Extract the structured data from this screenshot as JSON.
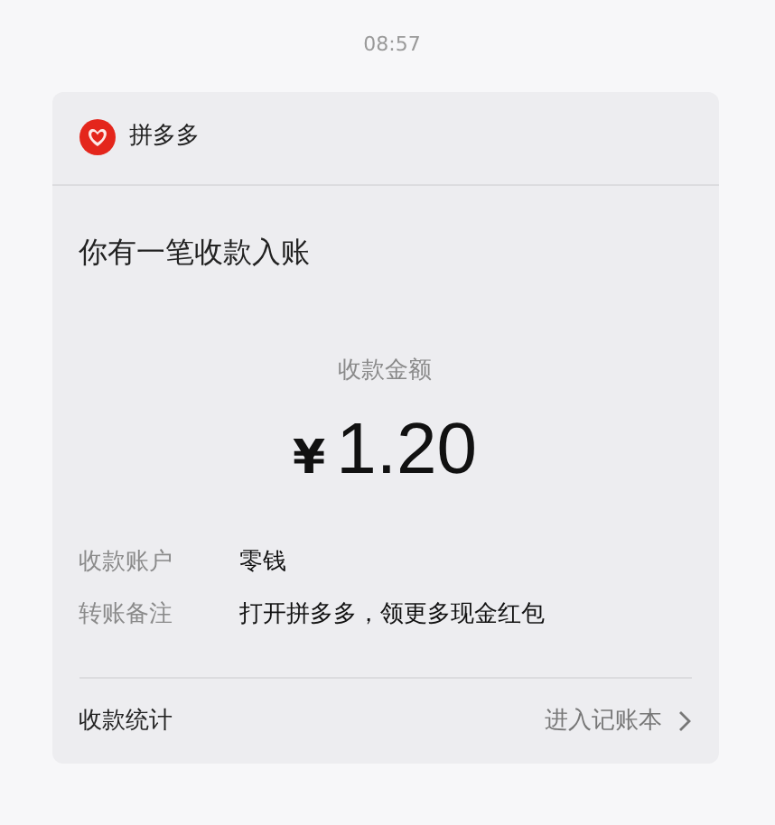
{
  "time": "08:57",
  "card": {
    "sender": "拼多多",
    "title": "你有一笔收款入账",
    "amount_label": "收款金额",
    "currency": "¥",
    "amount": "1.20",
    "details": [
      {
        "label": "收款账户",
        "value": "零钱"
      },
      {
        "label": "转账备注",
        "value": "打开拼多多，领更多现金红包"
      }
    ],
    "footer": {
      "label": "收款统计",
      "link": "进入记账本"
    }
  }
}
